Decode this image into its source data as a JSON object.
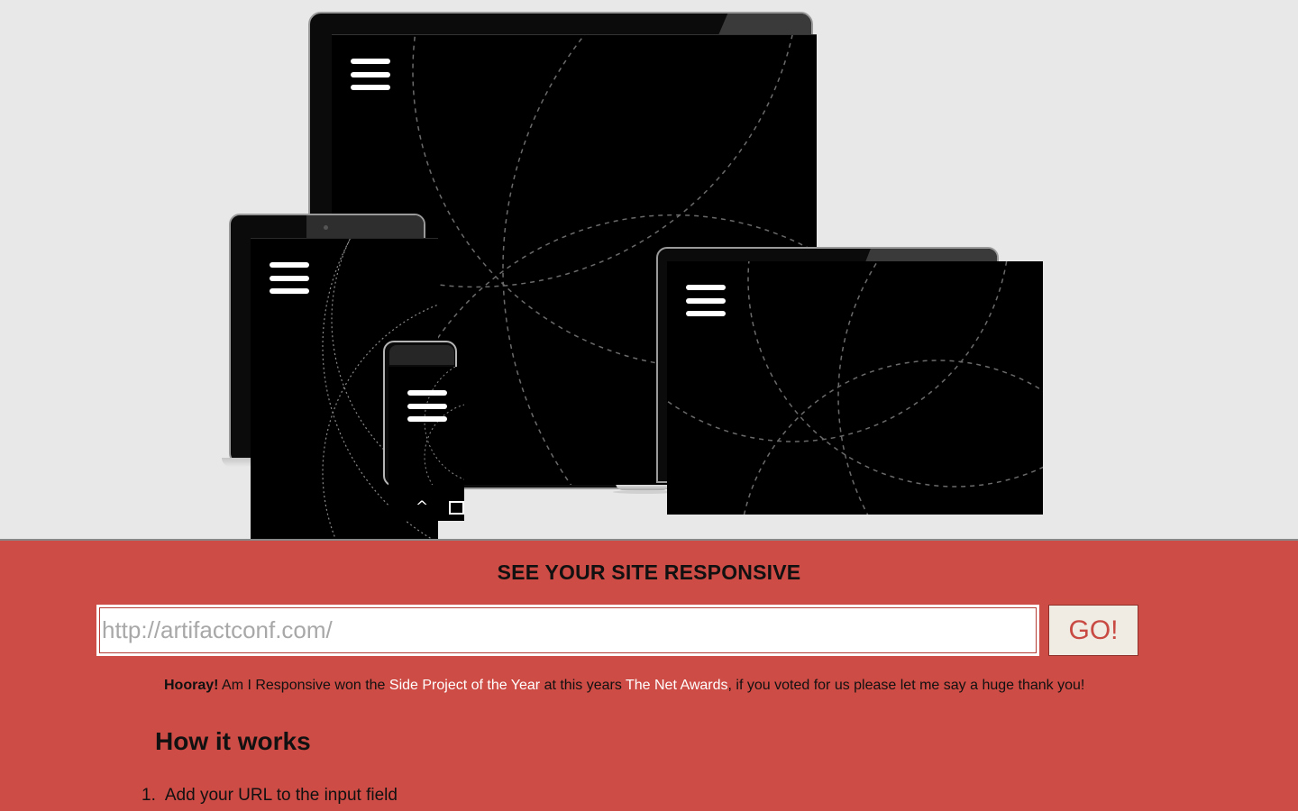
{
  "hero": {
    "devices": [
      {
        "id": "desktop",
        "icon": "hamburger-menu-icon"
      },
      {
        "id": "laptop",
        "icon": "hamburger-menu-icon"
      },
      {
        "id": "tablet",
        "icon": "hamburger-menu-icon"
      },
      {
        "id": "mobile",
        "icon": "hamburger-menu-icon",
        "nav_icons": [
          "chevron-up-icon",
          "square-icon"
        ]
      }
    ],
    "phone_up_glyph": "^"
  },
  "panel": {
    "heading": "SEE YOUR SITE RESPONSIVE",
    "url_input": {
      "placeholder": "http://artifactconf.com/"
    },
    "go_label": "GO!",
    "notice": {
      "lead": "Hooray!",
      "text1": " Am I Responsive won the ",
      "link1": "Side Project of the Year",
      "text2": " at this years ",
      "link2": "The Net Awards",
      "text3": ", if you voted for us please let me say a huge thank you!"
    },
    "how_heading": "How it works",
    "steps": [
      {
        "num": "1.",
        "text": "Add your URL to the input field"
      }
    ]
  },
  "colors": {
    "panel_bg": "#cd4c45",
    "page_bg": "#e8e8e8",
    "link": "#ffffff",
    "go_text": "#c84a42"
  }
}
